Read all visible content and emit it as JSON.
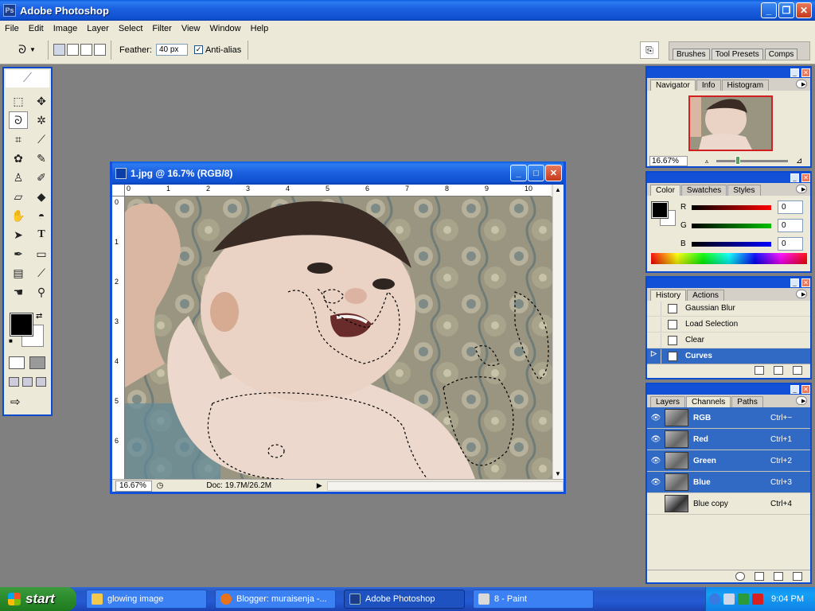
{
  "app": {
    "title": "Adobe Photoshop",
    "logo_text": "Ps"
  },
  "menu": [
    "File",
    "Edit",
    "Image",
    "Layer",
    "Select",
    "Filter",
    "View",
    "Window",
    "Help"
  ],
  "options": {
    "feather_label": "Feather:",
    "feather_value": "40 px",
    "antialias_label": "Anti-alias",
    "antialias_checked": true,
    "well_tabs": [
      "Brushes",
      "Tool Presets",
      "Comps"
    ]
  },
  "toolbox": {
    "tools": [
      "marquee-icon",
      "move-icon",
      "lasso-icon",
      "magic-wand-icon",
      "crop-icon",
      "slice-icon",
      "healing-brush-icon",
      "brush-icon",
      "clone-stamp-icon",
      "history-brush-icon",
      "eraser-icon",
      "paint-bucket-icon",
      "blur-icon",
      "dodge-icon",
      "path-selection-icon",
      "type-icon",
      "pen-icon",
      "shape-icon",
      "notes-icon",
      "eyedropper-icon",
      "hand-icon",
      "zoom-icon"
    ],
    "foreground_color": "#000000",
    "background_color": "#ffffff"
  },
  "document": {
    "title": "1.jpg @ 16.7% (RGB/8)",
    "zoom": "16.67%",
    "doc_size": "Doc: 19.7M/26.2M",
    "ruler_h": [
      "0",
      "1",
      "2",
      "3",
      "4",
      "5",
      "6",
      "7",
      "8",
      "9",
      "10"
    ],
    "ruler_v": [
      "0",
      "1",
      "2",
      "3",
      "4",
      "5",
      "6"
    ]
  },
  "navigator": {
    "tabs": [
      "Navigator",
      "Info",
      "Histogram"
    ],
    "zoom": "16.67%"
  },
  "color": {
    "tabs": [
      "Color",
      "Swatches",
      "Styles"
    ],
    "channels": [
      {
        "label": "R",
        "value": "0",
        "color": "#ff0000"
      },
      {
        "label": "G",
        "value": "0",
        "color": "#00c000"
      },
      {
        "label": "B",
        "value": "0",
        "color": "#0000ff"
      }
    ]
  },
  "history": {
    "tabs": [
      "History",
      "Actions"
    ],
    "items": [
      {
        "label": "Gaussian Blur",
        "selected": false
      },
      {
        "label": "Load Selection",
        "selected": false
      },
      {
        "label": "Clear",
        "selected": false
      },
      {
        "label": "Curves",
        "selected": true
      }
    ]
  },
  "channels": {
    "tabs": [
      "Layers",
      "Channels",
      "Paths"
    ],
    "items": [
      {
        "label": "RGB",
        "shortcut": "Ctrl+~",
        "visible": true,
        "selected": true
      },
      {
        "label": "Red",
        "shortcut": "Ctrl+1",
        "visible": true,
        "selected": true
      },
      {
        "label": "Green",
        "shortcut": "Ctrl+2",
        "visible": true,
        "selected": true
      },
      {
        "label": "Blue",
        "shortcut": "Ctrl+3",
        "visible": true,
        "selected": true
      },
      {
        "label": "Blue copy",
        "shortcut": "Ctrl+4",
        "visible": false,
        "selected": false
      }
    ]
  },
  "taskbar": {
    "start_label": "start",
    "tasks": [
      {
        "label": "glowing image",
        "color": "#f2c94c",
        "active": false
      },
      {
        "label": "Blogger: muraisenja -...",
        "color": "#e8731c",
        "active": false
      },
      {
        "label": "Adobe Photoshop",
        "color": "#1c3d8c",
        "active": true
      },
      {
        "label": "8 - Paint",
        "color": "#d9d9d9",
        "active": false
      }
    ],
    "clock": "9:04 PM"
  }
}
